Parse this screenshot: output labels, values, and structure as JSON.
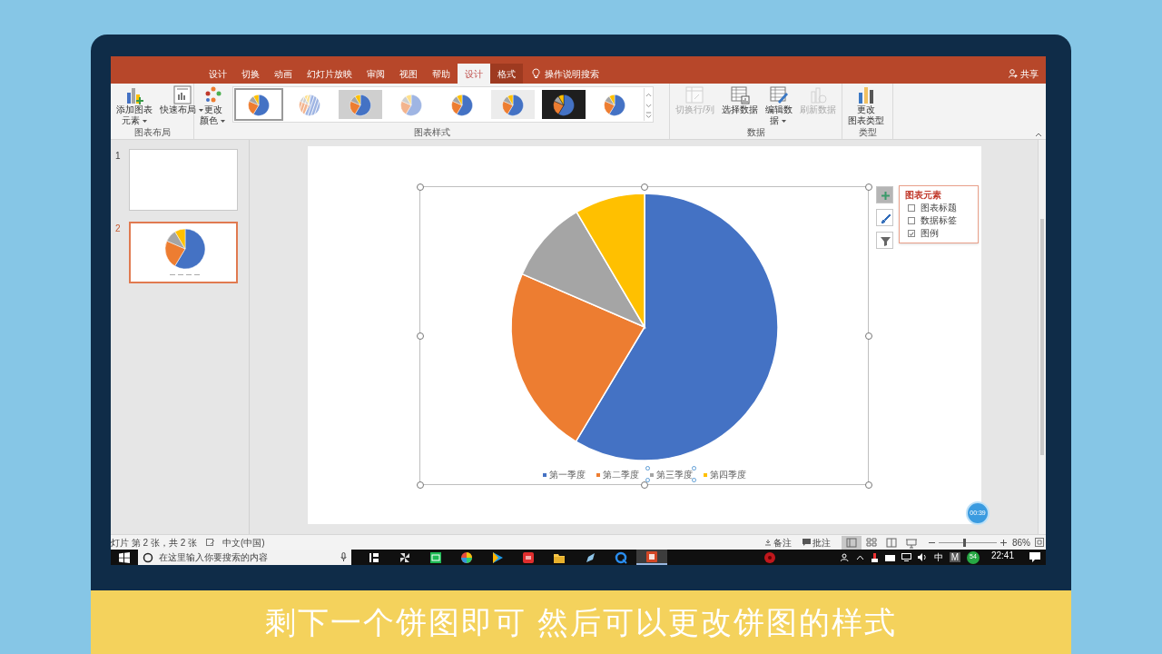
{
  "ribbon_tabs": [
    {
      "label": "设计",
      "kind": "normal",
      "selected": false
    },
    {
      "label": "切换",
      "kind": "normal",
      "selected": false
    },
    {
      "label": "动画",
      "kind": "normal",
      "selected": false
    },
    {
      "label": "幻灯片放映",
      "kind": "normal",
      "selected": false
    },
    {
      "label": "审阅",
      "kind": "normal",
      "selected": false
    },
    {
      "label": "视图",
      "kind": "normal",
      "selected": false
    },
    {
      "label": "帮助",
      "kind": "normal",
      "selected": false
    },
    {
      "label": "设计",
      "kind": "context",
      "selected": true
    },
    {
      "label": "格式",
      "kind": "context",
      "selected": false
    }
  ],
  "tell_me": "操作说明搜索",
  "share": "共享",
  "ribbon_groups": [
    {
      "label": "图表布局",
      "commands": [
        {
          "kind": "add-element",
          "lines": [
            "添加图表",
            "元素"
          ],
          "dropdown": true,
          "disabled": false
        },
        {
          "kind": "quick-layout",
          "lines": [
            "快速布局"
          ],
          "dropdown": true,
          "disabled": false
        }
      ]
    },
    {
      "label": "图表样式",
      "commands": [
        {
          "kind": "colors",
          "lines": [
            "更改",
            "颜色"
          ],
          "dropdown": true,
          "disabled": false
        }
      ],
      "gallery": [
        {
          "kind": "plain",
          "selected": true
        },
        {
          "kind": "hatched",
          "selected": false
        },
        {
          "kind": "shaded",
          "selected": false
        },
        {
          "kind": "pastel",
          "selected": false
        },
        {
          "kind": "plain",
          "selected": false
        },
        {
          "kind": "textured",
          "selected": false
        },
        {
          "kind": "dark",
          "selected": false
        },
        {
          "kind": "plain",
          "selected": false
        }
      ]
    },
    {
      "label": "数据",
      "commands": [
        {
          "kind": "switch",
          "lines": [
            "切换行/列"
          ],
          "dropdown": false,
          "disabled": true
        },
        {
          "kind": "select-data",
          "lines": [
            "选择数据"
          ],
          "dropdown": false,
          "disabled": false
        },
        {
          "kind": "edit-data",
          "lines": [
            "编辑数",
            "据"
          ],
          "dropdown": true,
          "disabled": false
        },
        {
          "kind": "refresh",
          "lines": [
            "刷新数据"
          ],
          "dropdown": false,
          "disabled": true
        }
      ]
    },
    {
      "label": "类型",
      "commands": [
        {
          "kind": "chart-type",
          "lines": [
            "更改",
            "图表类型"
          ],
          "dropdown": false,
          "disabled": false
        }
      ]
    }
  ],
  "slides_panel": [
    {
      "number": "1",
      "kind": "blank",
      "selected": false
    },
    {
      "number": "2",
      "kind": "pie",
      "selected": true
    }
  ],
  "chart": {
    "legend": [
      {
        "label": "第一季度",
        "color": "#4472c4",
        "selected": false
      },
      {
        "label": "第二季度",
        "color": "#ed7d31",
        "selected": false
      },
      {
        "label": "第三季度",
        "color": "#a5a5a5",
        "selected": true
      },
      {
        "label": "第四季度",
        "color": "#ffc000",
        "selected": false
      }
    ],
    "side_buttons": [
      {
        "kind": "plus",
        "selected": true
      },
      {
        "kind": "brush",
        "selected": false
      },
      {
        "kind": "filter",
        "selected": false
      }
    ],
    "elements_panel": {
      "title": "图表元素",
      "items": [
        {
          "label": "图表标题",
          "checked": false
        },
        {
          "label": "数据标签",
          "checked": false
        },
        {
          "label": "图例",
          "checked": true
        }
      ]
    }
  },
  "timer": "00:39",
  "status_bar": {
    "slide_info": "灯片 第 2 张，共 2 张",
    "language": "中文(中国)",
    "notes": "备注",
    "comments": "批注",
    "views": [
      {
        "kind": "normal",
        "selected": true
      },
      {
        "kind": "sorter",
        "selected": false
      },
      {
        "kind": "reading",
        "selected": false
      },
      {
        "kind": "show",
        "selected": false
      }
    ],
    "zoom": {
      "level": 0.42,
      "reading": "86%"
    }
  },
  "taskbar": {
    "search_placeholder": "在这里输入你要搜索的内容",
    "apps": [
      {
        "kind": "task-view",
        "active": false
      },
      {
        "kind": "pinwheel",
        "active": false
      },
      {
        "kind": "video-green",
        "active": false
      },
      {
        "kind": "colorwheel",
        "active": false
      },
      {
        "kind": "play",
        "active": false
      },
      {
        "kind": "red-app",
        "active": false
      },
      {
        "kind": "folder",
        "active": false
      },
      {
        "kind": "pen",
        "active": false
      },
      {
        "kind": "browser",
        "active": false
      },
      {
        "kind": "slides-app",
        "active": true
      },
      {
        "kind": "red-circle",
        "active": false
      }
    ],
    "ime": "中",
    "ime_mode": "M",
    "badge": "54",
    "time": "22:41"
  },
  "caption": "剩下一个饼图即可 然后可以更改饼图的样式"
}
